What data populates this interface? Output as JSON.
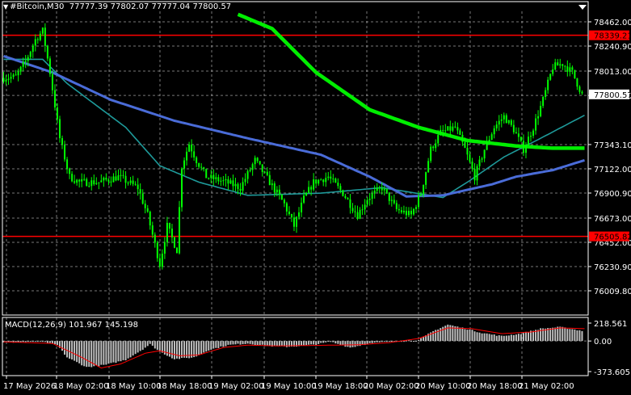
{
  "symbol_info": {
    "symbol": "#Bitcoin",
    "timeframe": "M30",
    "open": "77777.39",
    "high": "77802.07",
    "low": "77777.04",
    "close": "77800.57"
  },
  "price_axis": {
    "ticks": [
      "78462.00",
      "78240.90",
      "78013.00",
      "77790.90",
      "77343.10",
      "77122.00",
      "76900.90",
      "76673.00",
      "76452.00",
      "76230.90",
      "76009.80"
    ],
    "ymin": 76009.8,
    "ymax": 78462.0
  },
  "levels": [
    {
      "label": "78339.21",
      "value": 78339.21,
      "color": "#ff0000"
    },
    {
      "label": "76505.82",
      "value": 76505.82,
      "color": "#ff0000"
    }
  ],
  "current_price": {
    "label": "77800.57",
    "value": 77800.57
  },
  "macd": {
    "label": "MACD(12,26,9) 101.967 145.198",
    "ticks": [
      "218.561",
      "0.00",
      "-373.605"
    ],
    "ymax": 218.561,
    "ymin": -373.605
  },
  "time_axis": {
    "ticks": [
      "17 May 2026",
      "18 May 02:00",
      "18 May 10:00",
      "18 May 18:00",
      "19 May 02:00",
      "19 May 10:00",
      "19 May 18:00",
      "20 May 02:00",
      "20 May 10:00",
      "20 May 18:00",
      "21 May 02:00"
    ]
  },
  "colors": {
    "background": "#000000",
    "grid": "#c8c8c8",
    "candle": "#00ff00",
    "ma_fast": "#4a6cd8",
    "ma_mid": "#1e9a9a",
    "ma_slow": "#00ee00",
    "macd_hist": "#c0c0c0",
    "macd_signal": "#ff0000",
    "level": "#ff0000",
    "axis_text": "#ffffff"
  },
  "chart_data": {
    "type": "candlestick",
    "ylim": [
      76009.8,
      78462.0
    ],
    "anchors": [
      [
        0,
        77950
      ],
      [
        6,
        77960
      ],
      [
        10,
        78100
      ],
      [
        14,
        78300
      ],
      [
        17,
        78380
      ],
      [
        20,
        78000
      ],
      [
        24,
        77400
      ],
      [
        28,
        77050
      ],
      [
        32,
        77000
      ],
      [
        40,
        77000
      ],
      [
        48,
        77050
      ],
      [
        56,
        76950
      ],
      [
        60,
        76700
      ],
      [
        65,
        76250
      ],
      [
        68,
        76600
      ],
      [
        72,
        76380
      ],
      [
        74,
        77150
      ],
      [
        77,
        77350
      ],
      [
        80,
        77200
      ],
      [
        84,
        77050
      ],
      [
        92,
        77000
      ],
      [
        98,
        76950
      ],
      [
        104,
        77200
      ],
      [
        110,
        77000
      ],
      [
        116,
        76800
      ],
      [
        120,
        76600
      ],
      [
        124,
        76850
      ],
      [
        128,
        77000
      ],
      [
        134,
        77050
      ],
      [
        140,
        76900
      ],
      [
        146,
        76700
      ],
      [
        150,
        76850
      ],
      [
        156,
        76950
      ],
      [
        162,
        76750
      ],
      [
        168,
        76700
      ],
      [
        172,
        76900
      ],
      [
        176,
        77300
      ],
      [
        180,
        77450
      ],
      [
        186,
        77500
      ],
      [
        190,
        77300
      ],
      [
        194,
        77050
      ],
      [
        198,
        77300
      ],
      [
        202,
        77500
      ],
      [
        206,
        77600
      ],
      [
        210,
        77480
      ],
      [
        214,
        77300
      ],
      [
        218,
        77500
      ],
      [
        222,
        77750
      ],
      [
        226,
        78050
      ],
      [
        230,
        78080
      ],
      [
        234,
        78000
      ],
      [
        238,
        77800
      ]
    ],
    "ma_fast": [
      [
        0,
        78150
      ],
      [
        20,
        78000
      ],
      [
        44,
        77750
      ],
      [
        70,
        77560
      ],
      [
        100,
        77400
      ],
      [
        130,
        77250
      ],
      [
        150,
        77050
      ],
      [
        165,
        76870
      ],
      [
        180,
        76880
      ],
      [
        200,
        76980
      ],
      [
        210,
        77050
      ],
      [
        225,
        77110
      ],
      [
        238,
        77200
      ]
    ],
    "ma_mid": [
      [
        0,
        78120
      ],
      [
        16,
        78120
      ],
      [
        26,
        77900
      ],
      [
        50,
        77500
      ],
      [
        64,
        77150
      ],
      [
        80,
        77000
      ],
      [
        100,
        76880
      ],
      [
        130,
        76900
      ],
      [
        155,
        76950
      ],
      [
        180,
        76860
      ],
      [
        190,
        77000
      ],
      [
        205,
        77230
      ],
      [
        220,
        77400
      ],
      [
        238,
        77610
      ]
    ],
    "ma_slow": [
      [
        96,
        78530
      ],
      [
        110,
        78400
      ],
      [
        128,
        78000
      ],
      [
        150,
        77660
      ],
      [
        170,
        77500
      ],
      [
        190,
        77380
      ],
      [
        210,
        77330
      ],
      [
        225,
        77310
      ],
      [
        238,
        77310
      ]
    ],
    "macd_hist_anchors": [
      [
        0,
        -20
      ],
      [
        15,
        -5
      ],
      [
        22,
        -50
      ],
      [
        26,
        -200
      ],
      [
        34,
        -320
      ],
      [
        42,
        -290
      ],
      [
        50,
        -230
      ],
      [
        56,
        -120
      ],
      [
        60,
        -40
      ],
      [
        64,
        -130
      ],
      [
        70,
        -220
      ],
      [
        78,
        -200
      ],
      [
        84,
        -110
      ],
      [
        92,
        -50
      ],
      [
        100,
        -30
      ],
      [
        108,
        -60
      ],
      [
        116,
        -70
      ],
      [
        122,
        -60
      ],
      [
        128,
        -40
      ],
      [
        134,
        -10
      ],
      [
        142,
        -80
      ],
      [
        150,
        -30
      ],
      [
        160,
        0
      ],
      [
        170,
        10
      ],
      [
        176,
        120
      ],
      [
        182,
        200
      ],
      [
        188,
        160
      ],
      [
        196,
        100
      ],
      [
        204,
        60
      ],
      [
        212,
        90
      ],
      [
        220,
        150
      ],
      [
        228,
        170
      ],
      [
        238,
        120
      ]
    ],
    "macd_signal_anchors": [
      [
        0,
        -10
      ],
      [
        20,
        -30
      ],
      [
        32,
        -200
      ],
      [
        40,
        -330
      ],
      [
        48,
        -280
      ],
      [
        58,
        -150
      ],
      [
        64,
        -120
      ],
      [
        72,
        -180
      ],
      [
        80,
        -170
      ],
      [
        90,
        -80
      ],
      [
        100,
        -50
      ],
      [
        112,
        -60
      ],
      [
        124,
        -55
      ],
      [
        136,
        -50
      ],
      [
        146,
        -45
      ],
      [
        158,
        -20
      ],
      [
        170,
        30
      ],
      [
        182,
        160
      ],
      [
        192,
        150
      ],
      [
        204,
        90
      ],
      [
        216,
        110
      ],
      [
        228,
        160
      ],
      [
        238,
        150
      ]
    ]
  }
}
